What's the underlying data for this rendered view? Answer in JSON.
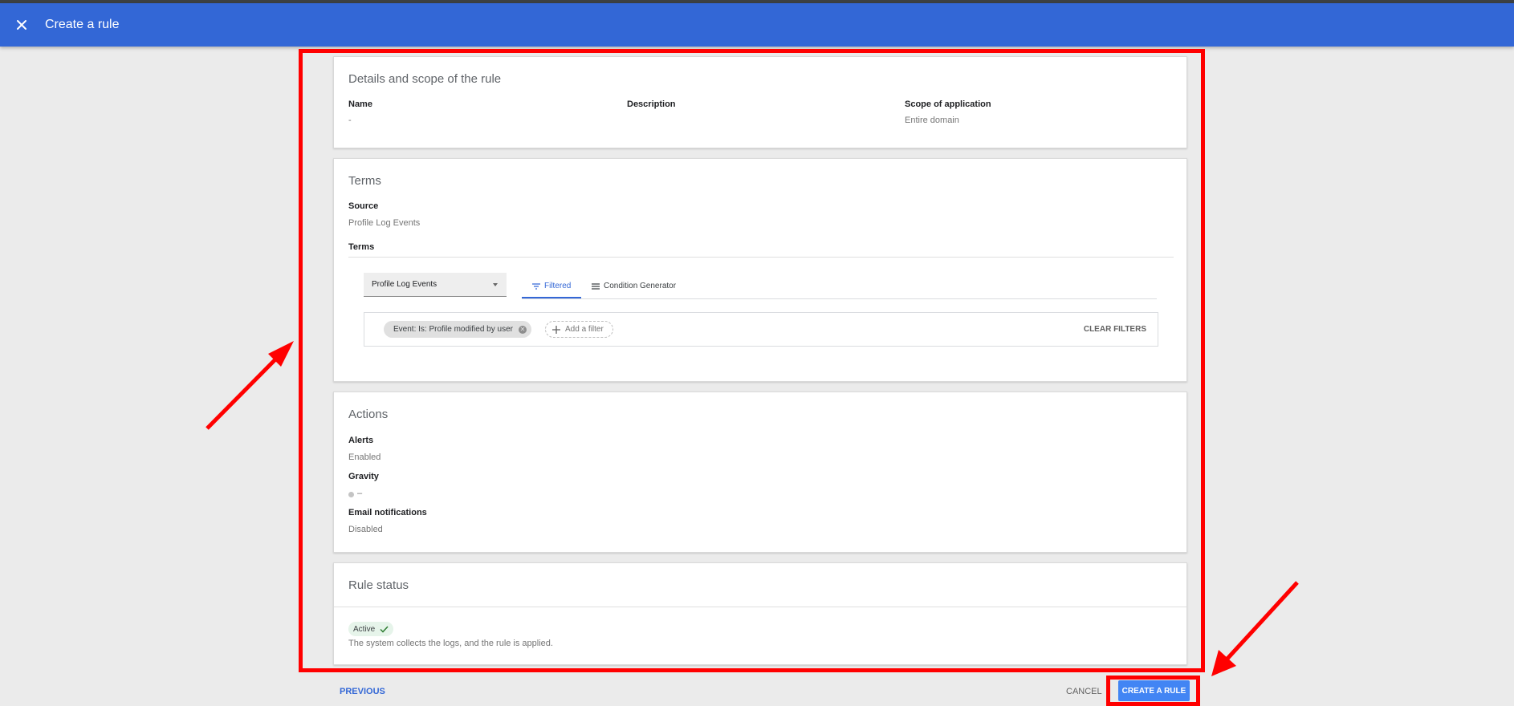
{
  "header": {
    "title": "Create a rule",
    "close_icon": "close-icon"
  },
  "details": {
    "title": "Details and scope of the rule",
    "name_label": "Name",
    "name_value": "-",
    "description_label": "Description",
    "description_value": "",
    "scope_label": "Scope of application",
    "scope_value": "Entire domain"
  },
  "terms": {
    "title": "Terms",
    "source_label": "Source",
    "source_value": "Profile Log Events",
    "terms_label": "Terms",
    "dropdown_value": "Profile Log Events",
    "tabs": [
      {
        "label": "Filtered",
        "icon": "filter-icon",
        "active": true
      },
      {
        "label": "Condition Generator",
        "icon": "list-icon",
        "active": false
      }
    ],
    "filter_chip": "Event: Is: Profile modified by user",
    "add_filter": "Add a filter",
    "clear_filters": "CLEAR FILTERS"
  },
  "actions": {
    "title": "Actions",
    "alerts_label": "Alerts",
    "alerts_value": "Enabled",
    "gravity_label": "Gravity",
    "gravity_value": "–",
    "email_label": "Email notifications",
    "email_value": "Disabled"
  },
  "rule_status": {
    "title": "Rule status",
    "badge": "Active",
    "description": "The system collects the logs, and the rule is applied."
  },
  "footer": {
    "previous": "PREVIOUS",
    "cancel": "CANCEL",
    "create": "CREATE A RULE"
  },
  "colors": {
    "appbar": "#3367d6",
    "primary_button": "#4285f4",
    "annotation": "#ff0000",
    "active_badge": "#e6f4ea"
  }
}
